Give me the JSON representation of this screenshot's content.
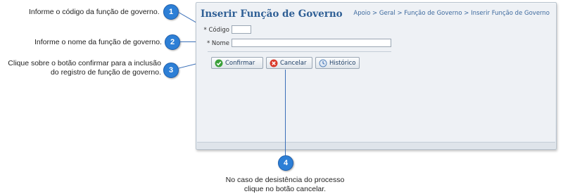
{
  "callouts": [
    {
      "number": "1",
      "text": "Informe o código da função de governo."
    },
    {
      "number": "2",
      "text": "Informe o nome da função de governo."
    },
    {
      "number": "3",
      "text_line1": "Clique sobre o botão confirmar para a inclusão",
      "text_line2": "do registro de função de governo."
    },
    {
      "number": "4",
      "text_line1": "No caso de desistência do processo",
      "text_line2": "clique no botão cancelar."
    }
  ],
  "form": {
    "title": "Inserir Função de Governo",
    "breadcrumb": "Apoio > Geral > Função de Governo > Inserir Função de Governo",
    "fields": {
      "codigo": {
        "label": "* Código",
        "value": ""
      },
      "nome": {
        "label": "* Nome",
        "value": ""
      }
    }
  },
  "buttons": {
    "confirmar": "Confirmar",
    "cancelar": "Cancelar",
    "historico": "Histórico"
  },
  "icons": {
    "confirmar": "check-circle-icon",
    "cancelar": "cancel-x-icon",
    "historico": "history-icon"
  },
  "colors": {
    "badge": "#2d7fd6",
    "title": "#2f5f95",
    "confirm_icon": "#3aa03a",
    "cancel_icon": "#d93a2b"
  }
}
